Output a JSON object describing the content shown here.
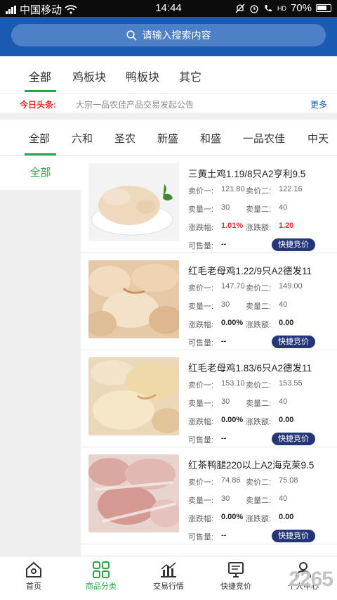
{
  "status_bar": {
    "carrier": "中国移动",
    "time": "14:44",
    "battery": "70%",
    "network": "HD"
  },
  "search": {
    "placeholder": "请输入搜索内容"
  },
  "top_tabs": [
    "全部",
    "鸡板块",
    "鸭板块",
    "其它"
  ],
  "news": {
    "tag": "今日头条:",
    "text": "大宗一品农佳产品交易发起公告",
    "more": "更多"
  },
  "store_tabs": [
    "全部",
    "六和",
    "圣农",
    "新盛",
    "和盛",
    "一品农佳",
    "中天"
  ],
  "sidebar": {
    "items": [
      "全部"
    ]
  },
  "labels": {
    "price1": "卖价一:",
    "price2": "卖价二:",
    "qty1": "卖量一:",
    "qty2": "卖量二:",
    "change_pct": "涨跌幅:",
    "change_amt": "涨跌额:",
    "available": "可售量:",
    "quick_bid": "快捷竞价"
  },
  "products": [
    {
      "title": "三黄土鸡1.19/8只A2亨利9.5",
      "price1": "121.80",
      "price2": "122.16",
      "qty1": "30",
      "qty2": "40",
      "change_pct": "1.01%",
      "change_amt": "1.20",
      "available": "--"
    },
    {
      "title": "红毛老母鸡1.22/9只A2德发11",
      "price1": "147.70",
      "price2": "149.00",
      "qty1": "30",
      "qty2": "40",
      "change_pct": "0.00%",
      "change_amt": "0.00",
      "available": "--"
    },
    {
      "title": "红毛老母鸡1.83/6只A2德发11",
      "price1": "153.10",
      "price2": "153.55",
      "qty1": "30",
      "qty2": "40",
      "change_pct": "0.00%",
      "change_amt": "0.00",
      "available": "--"
    },
    {
      "title": "红茶鸭腿220以上A2海克莱9.5",
      "price1": "74.86",
      "price2": "75.08",
      "qty1": "30",
      "qty2": "40",
      "change_pct": "0.00%",
      "change_amt": "0.00",
      "available": "--"
    }
  ],
  "bottom_nav": [
    "首页",
    "商品分类",
    "交易行情",
    "快捷竞价",
    "个人中心"
  ],
  "watermark": "2265",
  "colors": {
    "header": "#1a5ab2",
    "accent_green": "#2aa34a",
    "button_navy": "#24357a",
    "up_red": "#e0302c"
  }
}
